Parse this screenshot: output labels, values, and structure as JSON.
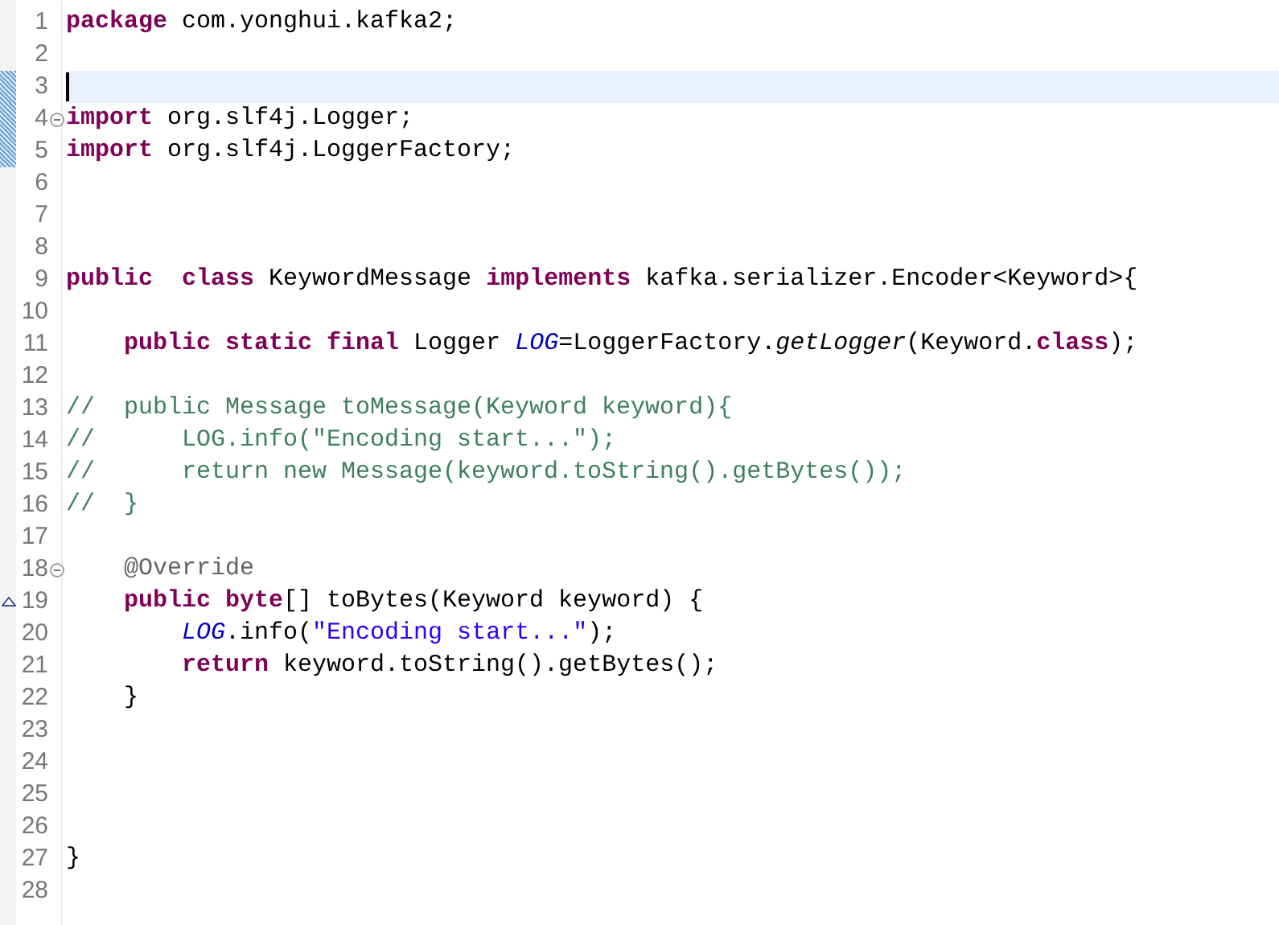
{
  "editor": {
    "lines": [
      {
        "number": "1",
        "tokens": [
          {
            "kind": "keyword",
            "text": "package"
          },
          {
            "kind": "plain",
            "text": " com.yonghui.kafka2;"
          }
        ]
      },
      {
        "number": "2"
      },
      {
        "number": "3",
        "current": true,
        "caret": true,
        "changed": true
      },
      {
        "number": "4",
        "changed": true,
        "fold": true,
        "tokens": [
          {
            "kind": "keyword",
            "text": "import"
          },
          {
            "kind": "plain",
            "text": " org.slf4j.Logger;"
          }
        ]
      },
      {
        "number": "5",
        "changed": true,
        "tokens": [
          {
            "kind": "keyword",
            "text": "import"
          },
          {
            "kind": "plain",
            "text": " org.slf4j.LoggerFactory;"
          }
        ]
      },
      {
        "number": "6"
      },
      {
        "number": "7"
      },
      {
        "number": "8"
      },
      {
        "number": "9",
        "tokens": [
          {
            "kind": "keyword",
            "text": "public"
          },
          {
            "kind": "keyword",
            "text": "  class"
          },
          {
            "kind": "plain",
            "text": " KeywordMessage "
          },
          {
            "kind": "keyword",
            "text": "implements"
          },
          {
            "kind": "plain",
            "text": " kafka.serializer.Encoder<Keyword>{"
          }
        ]
      },
      {
        "number": "10"
      },
      {
        "number": "11",
        "tokens": [
          {
            "kind": "keyword",
            "text": "    public static final"
          },
          {
            "kind": "plain",
            "text": " Logger "
          },
          {
            "kind": "field",
            "text": "LOG"
          },
          {
            "kind": "plain",
            "text": "=LoggerFactory."
          },
          {
            "kind": "static_method",
            "text": "getLogger"
          },
          {
            "kind": "plain",
            "text": "(Keyword."
          },
          {
            "kind": "keyword",
            "text": "class"
          },
          {
            "kind": "plain",
            "text": ");"
          }
        ]
      },
      {
        "number": "12"
      },
      {
        "number": "13",
        "tokens": [
          {
            "kind": "comment",
            "text": "//  public Message toMessage(Keyword keyword){"
          }
        ]
      },
      {
        "number": "14",
        "tokens": [
          {
            "kind": "comment",
            "text": "//      LOG.info(\"Encoding start...\");"
          }
        ]
      },
      {
        "number": "15",
        "tokens": [
          {
            "kind": "comment",
            "text": "//      return new Message(keyword.toString().getBytes());"
          }
        ]
      },
      {
        "number": "16",
        "tokens": [
          {
            "kind": "comment",
            "text": "//  }"
          }
        ]
      },
      {
        "number": "17"
      },
      {
        "number": "18",
        "fold": true,
        "tokens": [
          {
            "kind": "annotation",
            "text": "    @Override"
          }
        ]
      },
      {
        "number": "19",
        "override": true,
        "tokens": [
          {
            "kind": "keyword",
            "text": "    public byte"
          },
          {
            "kind": "plain",
            "text": "[] toBytes(Keyword keyword) {"
          }
        ]
      },
      {
        "number": "20",
        "tokens": [
          {
            "kind": "field",
            "text": "        LOG"
          },
          {
            "kind": "plain",
            "text": ".info("
          },
          {
            "kind": "string",
            "text": "\"Encoding start...\""
          },
          {
            "kind": "plain",
            "text": ");"
          }
        ]
      },
      {
        "number": "21",
        "tokens": [
          {
            "kind": "keyword",
            "text": "        return"
          },
          {
            "kind": "plain",
            "text": " keyword.toString().getBytes();"
          }
        ]
      },
      {
        "number": "22",
        "tokens": [
          {
            "kind": "plain",
            "text": "    }"
          }
        ]
      },
      {
        "number": "23"
      },
      {
        "number": "24"
      },
      {
        "number": "25"
      },
      {
        "number": "26"
      },
      {
        "number": "27",
        "tokens": [
          {
            "kind": "plain",
            "text": "}"
          }
        ]
      },
      {
        "number": "28"
      }
    ]
  }
}
